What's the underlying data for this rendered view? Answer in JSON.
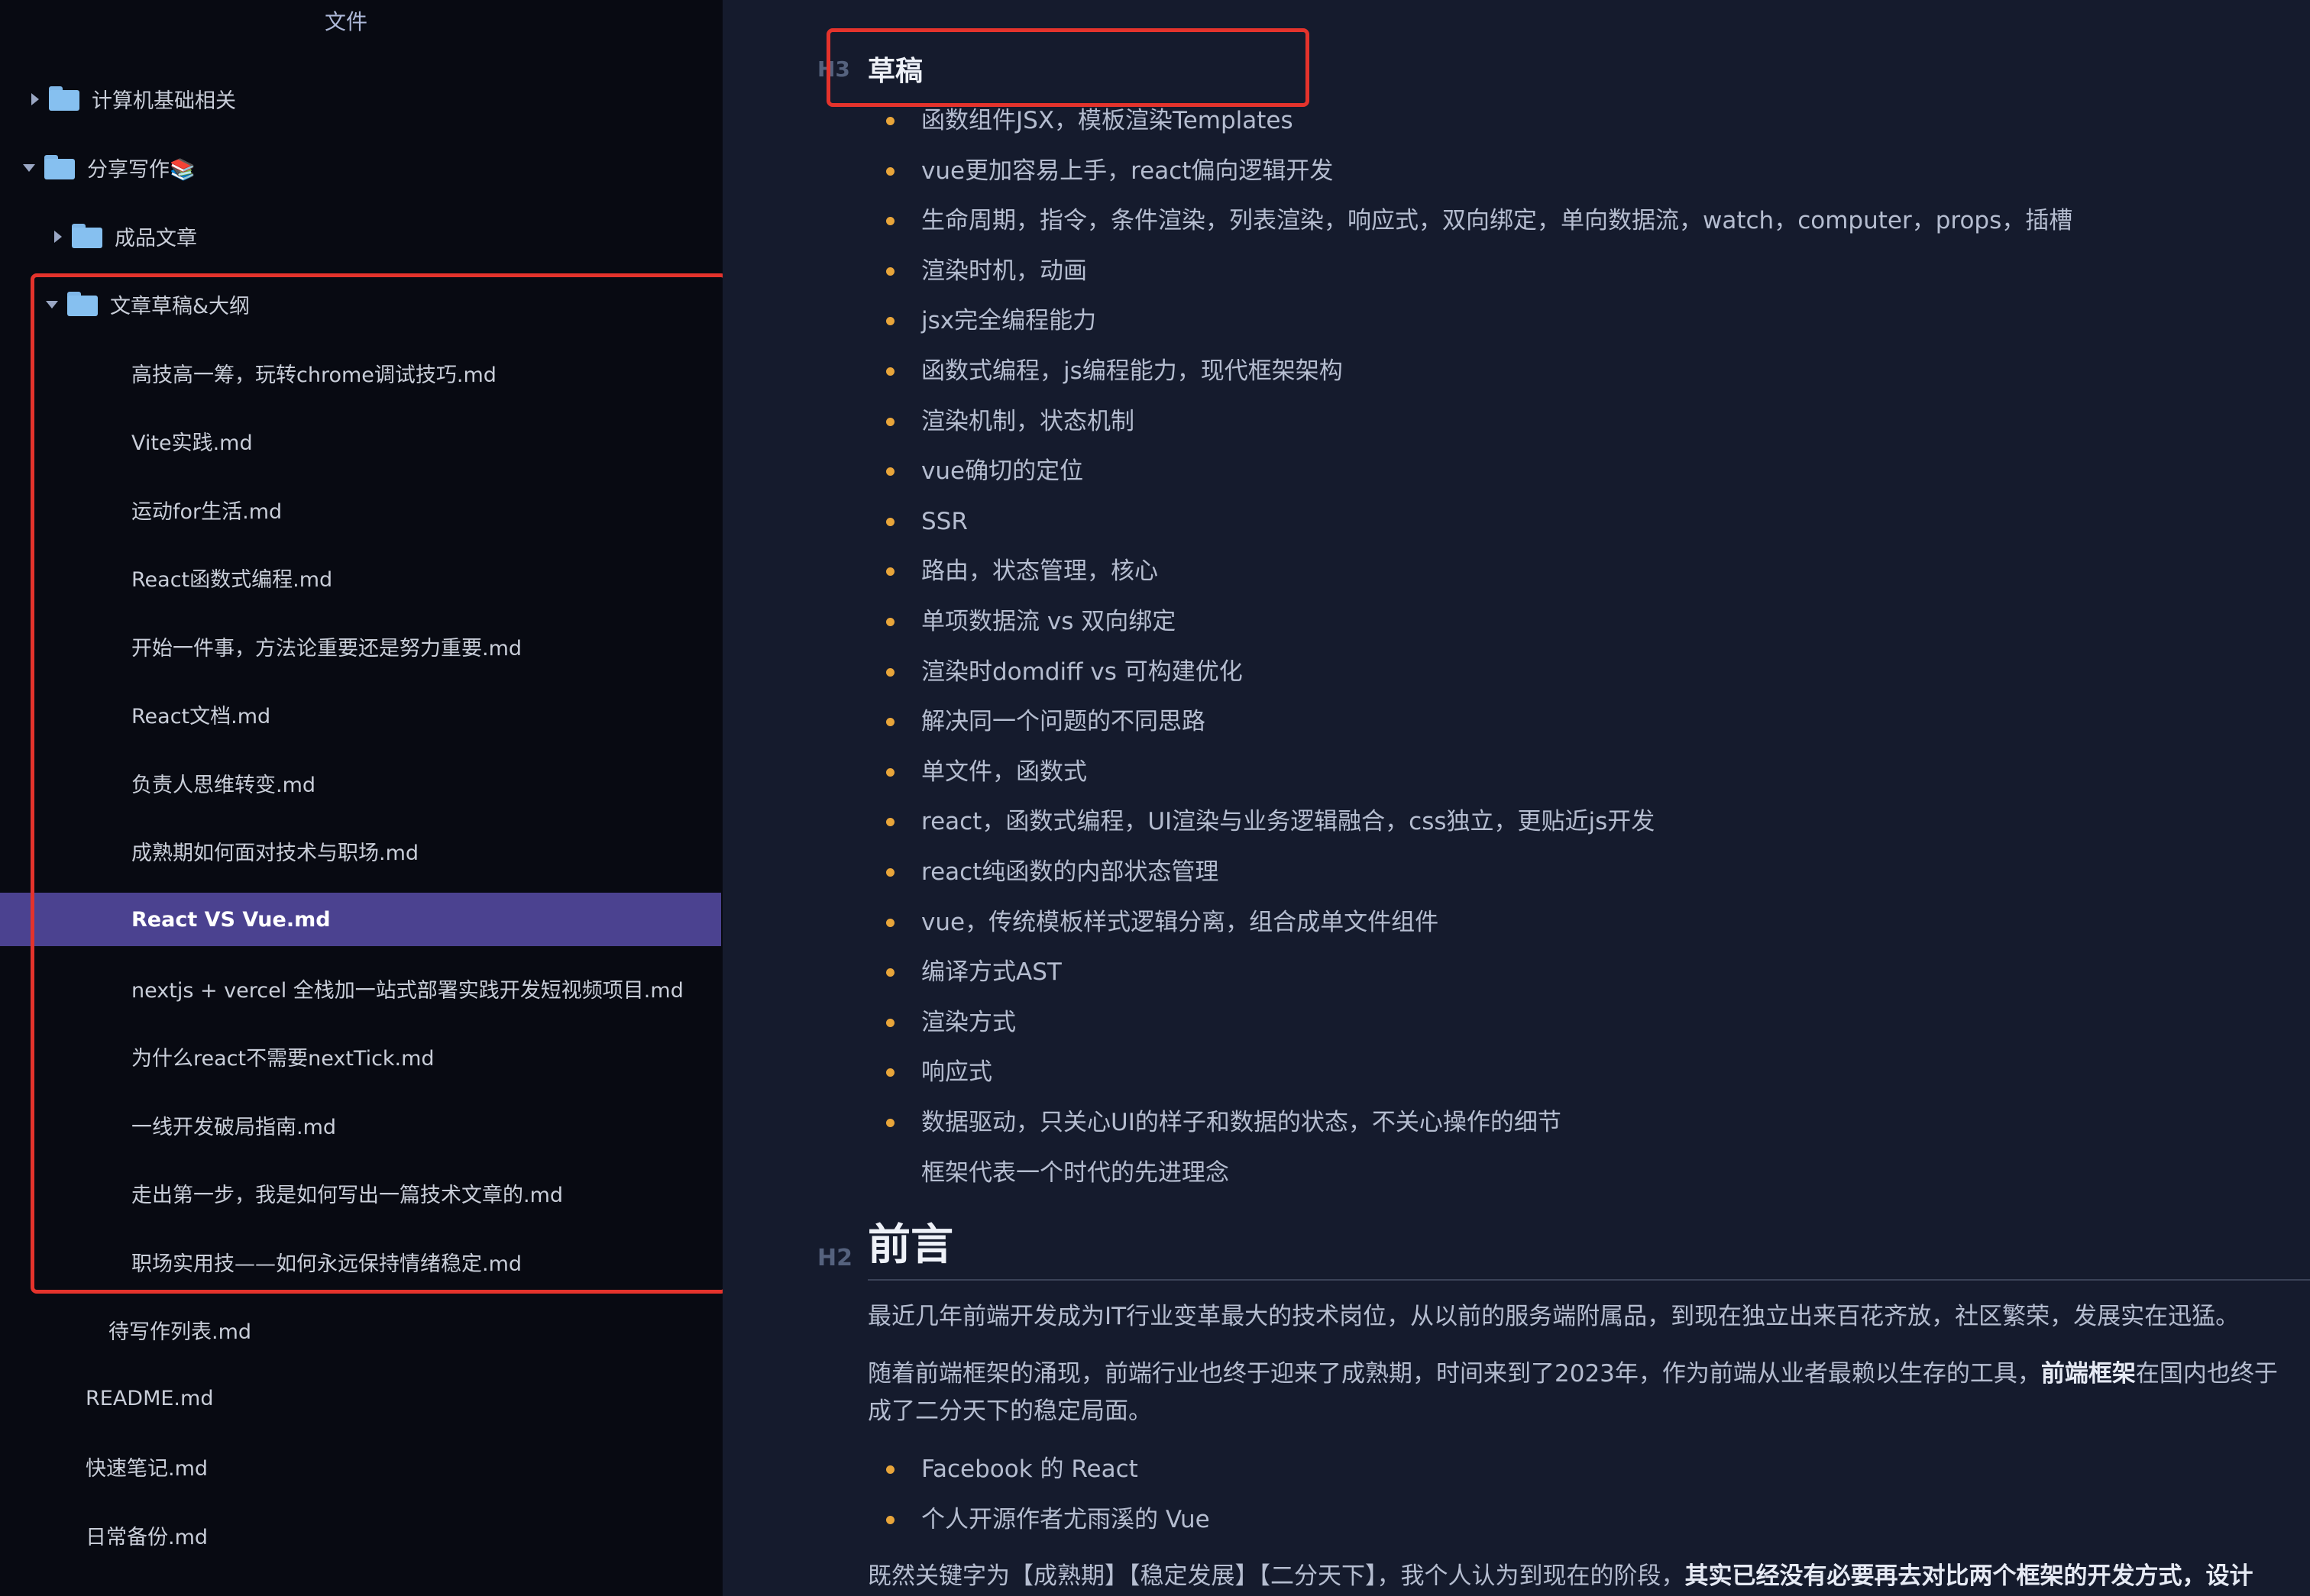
{
  "sidebar": {
    "title": "文件",
    "items": [
      {
        "label": "计算机基础相关",
        "type": "folder",
        "expanded": false
      },
      {
        "label": "分享写作📚",
        "type": "folder",
        "expanded": true
      },
      {
        "label": "成品文章",
        "type": "folder",
        "expanded": false
      },
      {
        "label": "文章草稿&大纲",
        "type": "folder",
        "expanded": true
      },
      {
        "label": "高技高一筹，玩转chrome调试技巧.md",
        "type": "file"
      },
      {
        "label": "Vite实践.md",
        "type": "file"
      },
      {
        "label": "运动for生活.md",
        "type": "file"
      },
      {
        "label": "React函数式编程.md",
        "type": "file"
      },
      {
        "label": "开始一件事，方法论重要还是努力重要.md",
        "type": "file"
      },
      {
        "label": "React文档.md",
        "type": "file"
      },
      {
        "label": "负责人思维转变.md",
        "type": "file"
      },
      {
        "label": "成熟期如何面对技术与职场.md",
        "type": "file"
      },
      {
        "label": "React VS Vue.md",
        "type": "file",
        "selected": true
      },
      {
        "label": "nextjs + vercel 全栈加一站式部署实践开发短视频项目.md",
        "type": "file"
      },
      {
        "label": "为什么react不需要nextTick.md",
        "type": "file"
      },
      {
        "label": "一线开发破局指南.md",
        "type": "file"
      },
      {
        "label": "走出第一步，我是如何写出一篇技术文章的.md",
        "type": "file"
      },
      {
        "label": "职场实用技——如何永远保持情绪稳定.md",
        "type": "file"
      },
      {
        "label": "待写作列表.md",
        "type": "file"
      },
      {
        "label": "README.md",
        "type": "file"
      },
      {
        "label": "快速笔记.md",
        "type": "file"
      },
      {
        "label": "日常备份.md",
        "type": "file"
      }
    ]
  },
  "editor": {
    "h3_badge": "H3",
    "h3_title": "草稿",
    "bullets": [
      "函数组件JSX，模板渲染Templates",
      "vue更加容易上手，react偏向逻辑开发",
      "生命周期，指令，条件渲染，列表渲染，响应式，双向绑定，单向数据流，watch，computer，props，插槽",
      "渲染时机，动画",
      "jsx完全编程能力",
      "函数式编程，js编程能力，现代框架架构",
      "渲染机制，状态机制",
      "vue确切的定位",
      "SSR",
      "路由，状态管理，核心",
      "单项数据流 vs 双向绑定",
      "渲染时domdiff vs 可构建优化",
      "解决同一个问题的不同思路",
      "单文件，函数式",
      "react，函数式编程，UI渲染与业务逻辑融合，css独立，更贴近js开发",
      "react纯函数的内部状态管理",
      "vue，传统模板样式逻辑分离，组合成单文件组件",
      "编译方式AST",
      "渲染方式",
      "响应式",
      "数据驱动，只关心UI的样子和数据的状态，不关心操作的细节"
    ],
    "continuation": "框架代表一个时代的先进理念",
    "h2_badge": "H2",
    "h2_title": "前言",
    "para1": "最近几年前端开发成为IT行业变革最大的技术岗位，从以前的服务端附属品，到现在独立出来百花齐放，社区繁荣，发展实在迅猛。",
    "para2_pre": "随着前端框架的涌现，前端行业也终于迎来了成熟期，时间来到了2023年，作为前端从业者最赖以生存的工具，",
    "para2_bold": "前端框架",
    "para2_post": "在国内也终于",
    "para2_line2": "成了二分天下的稳定局面。",
    "bullets2": [
      "Facebook 的 React",
      "个人开源作者尤雨溪的 Vue"
    ],
    "para3_pre": "既然关键字为【成熟期】【稳定发展】【二分天下】，我个人认为到现在的阶段，",
    "para3_bold": "其实已经没有必要再去对比两个框架的开发方式，设计"
  },
  "colors": {
    "sidebar_bg": "#080a12",
    "editor_bg": "#151b2d",
    "selection": "#4b4290",
    "bullet": "#e8a53a",
    "highlight_box": "#e4332c",
    "folder": "#86c0f0"
  }
}
